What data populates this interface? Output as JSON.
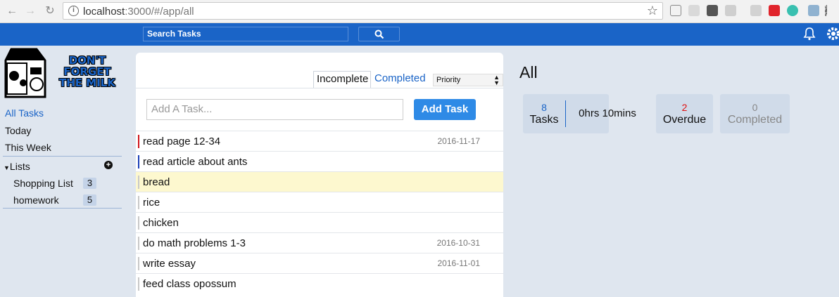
{
  "browser": {
    "url_host": "localhost",
    "url_rest": ":3000/#/app/all"
  },
  "header": {
    "search_placeholder": "Search Tasks"
  },
  "logo": {
    "text": "DON'T FORGET THE MILK"
  },
  "sidebar": {
    "nav": [
      {
        "label": "All Tasks",
        "active": true
      },
      {
        "label": "Today",
        "active": false
      },
      {
        "label": "This Week",
        "active": false
      }
    ],
    "lists_label": "Lists",
    "lists": [
      {
        "label": "Shopping List",
        "count": "3"
      },
      {
        "label": "homework",
        "count": "5"
      }
    ]
  },
  "tasks_panel": {
    "tabs": {
      "incomplete": "Incomplete",
      "completed": "Completed"
    },
    "sort_selected": "Priority",
    "add_placeholder": "Add A Task...",
    "add_button": "Add Task",
    "tasks": [
      {
        "name": "read page 12-34",
        "date": "2016-11-17",
        "priority_color": "#d0161c",
        "highlight": false
      },
      {
        "name": "read article about ants",
        "date": "",
        "priority_color": "#1a3fb8",
        "highlight": false
      },
      {
        "name": "bread",
        "date": "",
        "priority_color": "#c8c8c8",
        "highlight": true
      },
      {
        "name": "rice",
        "date": "",
        "priority_color": "#c8c8c8",
        "highlight": false
      },
      {
        "name": "chicken",
        "date": "",
        "priority_color": "#c8c8c8",
        "highlight": false
      },
      {
        "name": "do math problems 1-3",
        "date": "2016-10-31",
        "priority_color": "#c8c8c8",
        "highlight": false
      },
      {
        "name": "write essay",
        "date": "2016-11-01",
        "priority_color": "#c8c8c8",
        "highlight": false
      },
      {
        "name": "feed class opossum",
        "date": "",
        "priority_color": "#c8c8c8",
        "highlight": false
      }
    ]
  },
  "summary": {
    "title": "All",
    "tasks_count": "8",
    "tasks_label": "Tasks",
    "time_estimate": "0hrs 10mins",
    "overdue_count": "2",
    "overdue_label": "Overdue",
    "completed_count": "0",
    "completed_label": "Completed"
  },
  "colors": {
    "brand_blue": "#1a64c7",
    "overdue_red": "#e01010",
    "highlight_yellow": "#fdf8cf"
  }
}
